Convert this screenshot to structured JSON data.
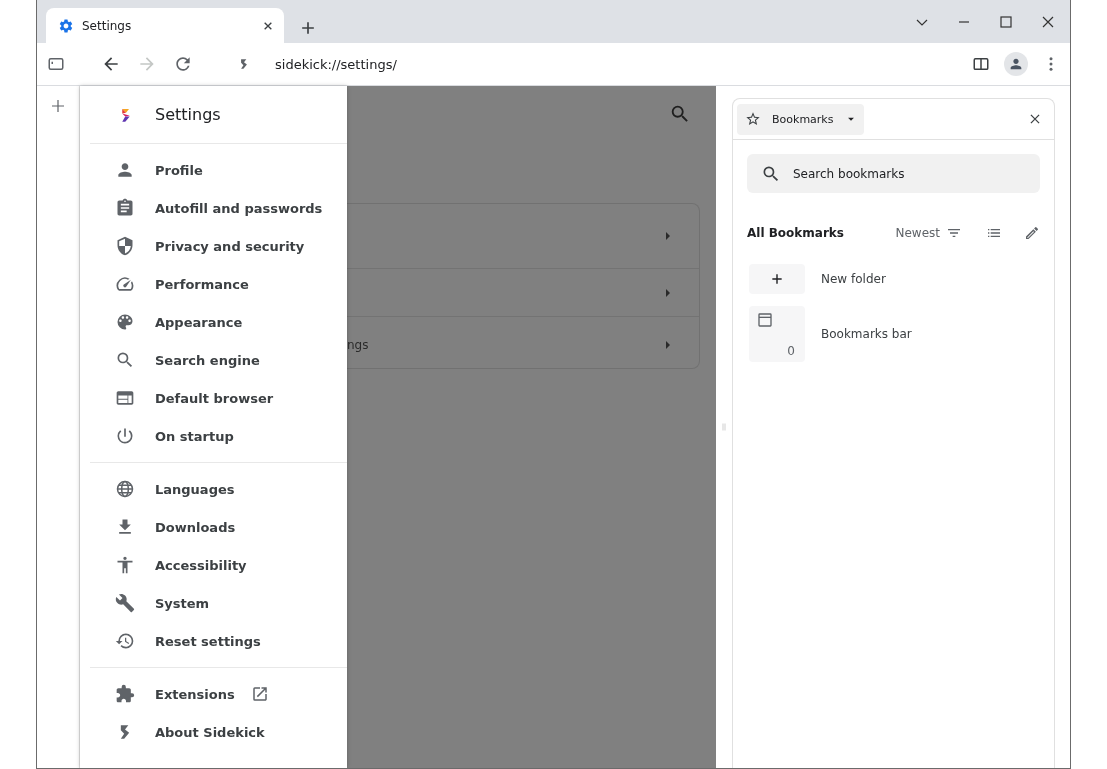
{
  "window": {
    "tabs": [
      {
        "title": "Settings",
        "selected": true
      }
    ]
  },
  "toolbar": {
    "url": "sidekick://settings/",
    "forward_disabled": true
  },
  "settings_drawer": {
    "title": "Settings",
    "groups": [
      [
        {
          "label": "Profile",
          "kind": "page"
        },
        {
          "label": "Autofill and passwords",
          "kind": "page"
        },
        {
          "label": "Privacy and security",
          "kind": "page"
        },
        {
          "label": "Performance",
          "kind": "page"
        },
        {
          "label": "Appearance",
          "kind": "page"
        },
        {
          "label": "Search engine",
          "kind": "page"
        },
        {
          "label": "Default browser",
          "kind": "page"
        },
        {
          "label": "On startup",
          "kind": "page"
        }
      ],
      [
        {
          "label": "Languages",
          "kind": "page"
        },
        {
          "label": "Downloads",
          "kind": "page"
        },
        {
          "label": "Accessibility",
          "kind": "page"
        },
        {
          "label": "System",
          "kind": "page"
        },
        {
          "label": "Reset settings",
          "kind": "page"
        }
      ],
      [
        {
          "label": "Extensions",
          "kind": "external"
        },
        {
          "label": "About Sidekick",
          "kind": "page"
        }
      ]
    ]
  },
  "background_page": {
    "rows": [
      {
        "expandable": true
      },
      {
        "expandable": true
      },
      {
        "label": "ngs",
        "expandable": true
      }
    ]
  },
  "bookmarks_panel": {
    "title": "Bookmarks",
    "search": {
      "placeholder": "Search bookmarks"
    },
    "heading": "All Bookmarks",
    "sort": "Newest",
    "items": [
      {
        "kind": "action",
        "label": "New folder"
      },
      {
        "kind": "folder",
        "label": "Bookmarks bar",
        "count": "0"
      }
    ]
  }
}
